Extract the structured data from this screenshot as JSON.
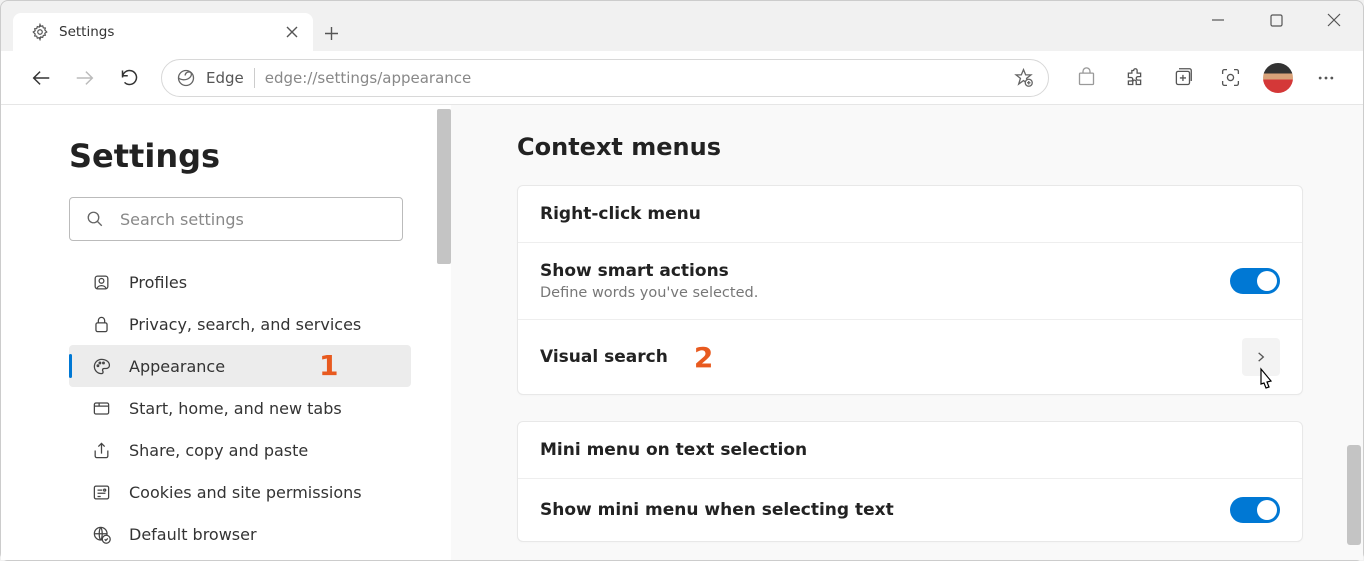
{
  "window": {
    "tab_title": "Settings"
  },
  "toolbar": {
    "site_label": "Edge",
    "url": "edge://settings/appearance"
  },
  "sidebar": {
    "title": "Settings",
    "search_placeholder": "Search settings",
    "items": [
      {
        "label": "Profiles"
      },
      {
        "label": "Privacy, search, and services"
      },
      {
        "label": "Appearance"
      },
      {
        "label": "Start, home, and new tabs"
      },
      {
        "label": "Share, copy and paste"
      },
      {
        "label": "Cookies and site permissions"
      },
      {
        "label": "Default browser"
      }
    ]
  },
  "main": {
    "section_title": "Context menus",
    "card1": {
      "row1": {
        "title": "Right-click menu"
      },
      "row2": {
        "title": "Show smart actions",
        "desc": "Define words you've selected."
      },
      "row3": {
        "title": "Visual search"
      }
    },
    "card2": {
      "row1": {
        "title": "Mini menu on text selection"
      },
      "row2": {
        "title": "Show mini menu when selecting text"
      }
    }
  },
  "annotations": {
    "one": "1",
    "two": "2"
  }
}
